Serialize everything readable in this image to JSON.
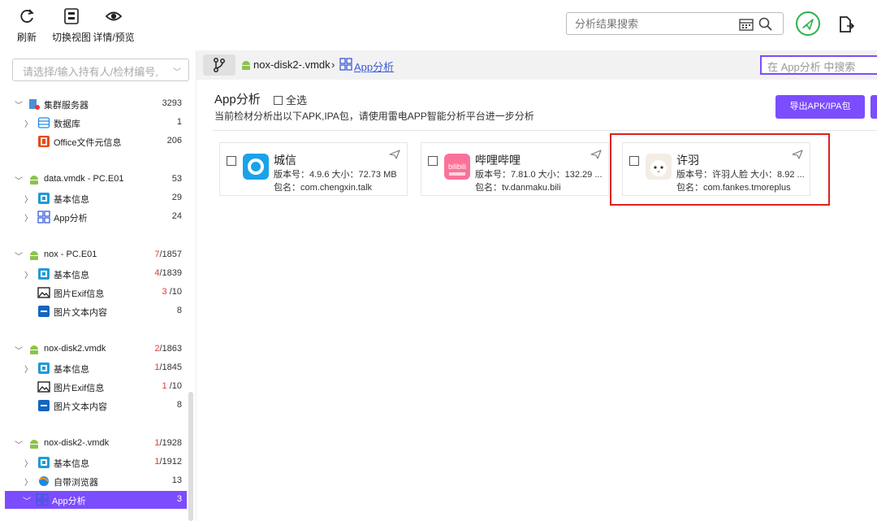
{
  "toolbar": {
    "refresh_label": "刷新",
    "switch_view_label": "切换视图",
    "detail_preview_label": "详情/预览",
    "search_placeholder": "分析结果搜索"
  },
  "left_panel": {
    "select_placeholder": "请选择/输入持有人/检材编号,",
    "tree": [
      {
        "label": "集群服务器",
        "count": "3293",
        "red_count": "",
        "icon": "cluster-server-icon",
        "arrow": "down",
        "indent": 0
      },
      {
        "label": "数据库",
        "count": "1",
        "red_count": "",
        "icon": "database-icon",
        "arrow": "right",
        "indent": 1
      },
      {
        "label": "Office文件元信息",
        "count": "206",
        "red_count": "",
        "icon": "office-icon",
        "arrow": "",
        "indent": 1
      },
      {
        "label": "data.vmdk - PC.E01",
        "count": "53",
        "red_count": "",
        "icon": "android-icon",
        "arrow": "down",
        "indent": 0
      },
      {
        "label": "基本信息",
        "count": "29",
        "red_count": "",
        "icon": "basic-info-icon",
        "arrow": "right",
        "indent": 1
      },
      {
        "label": "App分析",
        "count": "24",
        "red_count": "",
        "icon": "app-grid-icon",
        "arrow": "right",
        "indent": 1
      },
      {
        "label": "nox - PC.E01",
        "count": "/1857",
        "red_count": "7",
        "icon": "android-icon",
        "arrow": "down",
        "indent": 0
      },
      {
        "label": "基本信息",
        "count": "/1839",
        "red_count": "4",
        "icon": "basic-info-icon",
        "arrow": "right",
        "indent": 1
      },
      {
        "label": "图片Exif信息",
        "count": " /10",
        "red_count": "3",
        "icon": "image-icon",
        "arrow": "",
        "indent": 1
      },
      {
        "label": "图片文本内容",
        "count": "8",
        "red_count": "",
        "icon": "ocr-icon",
        "arrow": "",
        "indent": 1
      },
      {
        "label": "nox-disk2.vmdk",
        "count": "/1863",
        "red_count": "2",
        "icon": "android-icon",
        "arrow": "down",
        "indent": 0
      },
      {
        "label": "基本信息",
        "count": "/1845",
        "red_count": "1",
        "icon": "basic-info-icon",
        "arrow": "right",
        "indent": 1
      },
      {
        "label": "图片Exif信息",
        "count": " /10",
        "red_count": "1",
        "icon": "image-icon",
        "arrow": "",
        "indent": 1
      },
      {
        "label": "图片文本内容",
        "count": "8",
        "red_count": "",
        "icon": "ocr-icon",
        "arrow": "",
        "indent": 1
      },
      {
        "label": "nox-disk2-.vmdk",
        "count": "/1928",
        "red_count": "1",
        "icon": "android-icon",
        "arrow": "down",
        "indent": 0
      },
      {
        "label": "基本信息",
        "count": "/1912",
        "red_count": "1",
        "icon": "basic-info-icon",
        "arrow": "right",
        "indent": 1
      },
      {
        "label": "自带浏览器",
        "count": "13",
        "red_count": "",
        "icon": "browser-icon",
        "arrow": "right",
        "indent": 1
      },
      {
        "label": "App分析",
        "count": "3",
        "red_count": "",
        "icon": "app-grid-icon",
        "arrow": "down",
        "indent": 1,
        "active": true
      }
    ]
  },
  "breadcrumb": {
    "device": "nox-disk2-.vmdk",
    "separator": "›",
    "current": "App分析",
    "search_placeholder": "在 App分析 中搜索"
  },
  "main": {
    "title": "App分析",
    "select_all_label": "全选",
    "subtitle": "当前检材分析出以下APK,IPA包，请使用雷电APP智能分析平台进一步分析",
    "export_button": "导出APK/IPA包",
    "apps": [
      {
        "name": "城信",
        "version_line": "版本号：4.9.6   大小：72.73 MB",
        "package_line": "包名：com.chengxin.talk",
        "icon": "chengxin-app-icon"
      },
      {
        "name": "哔哩哔哩",
        "version_line": "版本号：7.81.0   大小：132.29 ...",
        "package_line": "包名：tv.danmaku.bili",
        "icon": "bilibili-app-icon",
        "icon_text": "bilibili"
      },
      {
        "name": "许羽",
        "version_line": "版本号：许羽人脸   大小：8.92 ...",
        "package_line": "包名：com.fankes.tmoreplus",
        "icon": "xuyu-app-icon"
      }
    ]
  },
  "colors": {
    "accent": "#7c4dff",
    "highlight_box": "#e02020",
    "count_red": "#e53935",
    "link": "#3a5bd9"
  }
}
